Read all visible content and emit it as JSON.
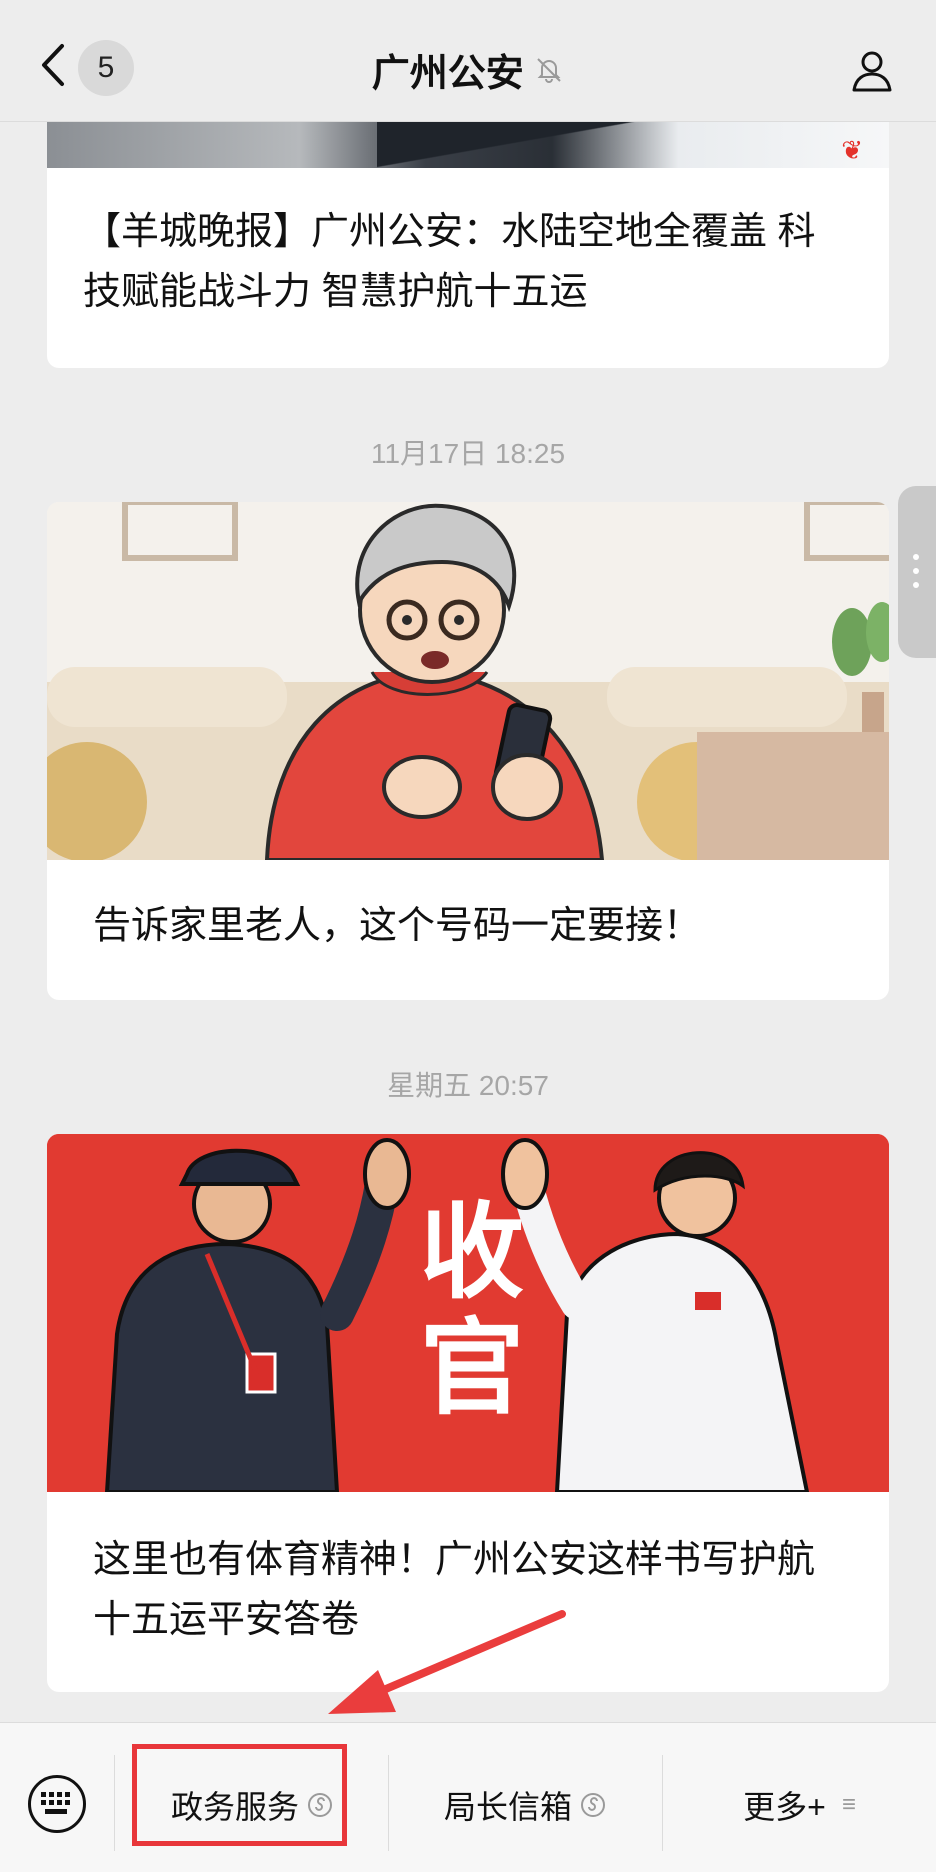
{
  "header": {
    "unread_count": "5",
    "title": "广州公安"
  },
  "timeline": [
    {
      "timestamp": "",
      "title": "【羊城晚报】广州公安：水陆空地全覆盖 科技赋能战斗力 智慧护航十五运"
    },
    {
      "timestamp": "11月17日 18:25",
      "title": "告诉家里老人，这个号码一定要接！"
    },
    {
      "timestamp": "星期五 20:57",
      "title": "这里也有体育精神！广州公安这样书写护航十五运平安答卷",
      "image_text": "收官"
    }
  ],
  "menu": {
    "items": [
      {
        "label": "政务服务"
      },
      {
        "label": "局长信箱"
      },
      {
        "label": "更多+"
      }
    ]
  },
  "colors": {
    "accent_red": "#e8363a",
    "card_bg": "#ffffff",
    "page_bg": "#ededed",
    "poster_red": "#e13a31"
  }
}
